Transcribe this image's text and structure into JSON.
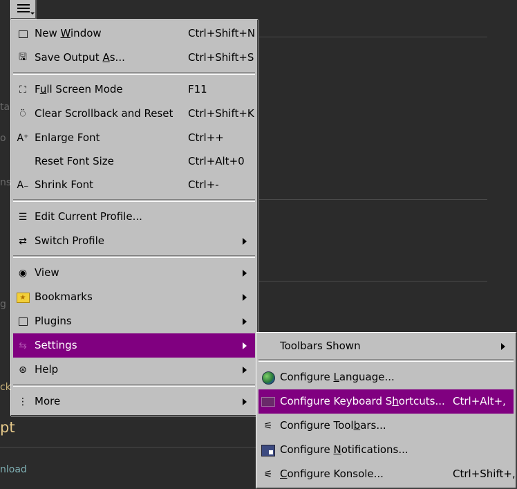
{
  "background": {
    "heading_fragment": "pt",
    "link_fragment": "nload",
    "fragments": [
      "ta",
      "o",
      "ns",
      "g",
      "ck"
    ]
  },
  "hamburger": {
    "icon": "hamburger-menu-icon"
  },
  "main_menu": {
    "items": [
      {
        "label_pre": "New ",
        "label_u": "W",
        "label_post": "indow",
        "shortcut": "Ctrl+Shift+N",
        "icon": "new-window-icon"
      },
      {
        "label_pre": "Save Output ",
        "label_u": "A",
        "label_post": "s...",
        "shortcut": "Ctrl+Shift+S",
        "icon": "save-output-icon"
      },
      {
        "label_pre": "F",
        "label_u": "u",
        "label_post": "ll Screen Mode",
        "shortcut": "F11",
        "icon": "fullscreen-icon"
      },
      {
        "label": "Clear Scrollback and Reset",
        "shortcut": "Ctrl+Shift+K",
        "icon": "clear-icon"
      },
      {
        "label": "Enlarge Font",
        "shortcut": "Ctrl++",
        "icon": "enlarge-font-icon"
      },
      {
        "label": "Reset Font Size",
        "shortcut": "Ctrl+Alt+0"
      },
      {
        "label": "Shrink Font",
        "shortcut": "Ctrl+-",
        "icon": "shrink-font-icon"
      },
      {
        "label": "Edit Current Profile...",
        "icon": "edit-profile-icon"
      },
      {
        "label": "Switch Profile",
        "icon": "switch-profile-icon"
      },
      {
        "label": "View",
        "icon": "eye-icon"
      },
      {
        "label": "Bookmarks",
        "icon": "bookmark-folder-icon"
      },
      {
        "label": "Plugins",
        "icon": "plugins-icon"
      },
      {
        "label": "Settings",
        "icon": "settings-icon"
      },
      {
        "label": "Help",
        "icon": "help-icon"
      },
      {
        "label": "More",
        "icon": "more-icon"
      }
    ]
  },
  "sub_menu": {
    "items": [
      {
        "label": "Toolbars Shown"
      },
      {
        "label_pre": "Configure ",
        "label_u": "L",
        "label_post": "anguage...",
        "icon": "globe-icon"
      },
      {
        "label_pre": "Configure Keyboard S",
        "label_u": "h",
        "label_post": "ortcuts...",
        "shortcut": "Ctrl+Alt+,",
        "icon": "keyboard-icon"
      },
      {
        "label_pre": "Configure Tool",
        "label_u": "b",
        "label_post": "ars...",
        "icon": "configure-toolbars-icon"
      },
      {
        "label_pre": "Configure ",
        "label_u": "N",
        "label_post": "otifications...",
        "icon": "notifications-icon"
      },
      {
        "label_pre": "",
        "label_u": "C",
        "label_post": "onfigure Konsole...",
        "shortcut": "Ctrl+Shift+,",
        "icon": "configure-konsole-icon"
      }
    ]
  },
  "colors": {
    "highlight": "#800080",
    "menu_bg": "#c0c0c0",
    "terminal_bg": "#2b2b2b"
  }
}
